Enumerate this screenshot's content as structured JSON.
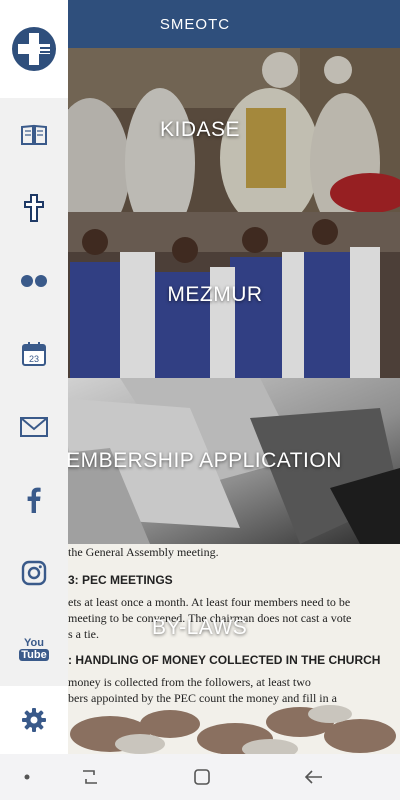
{
  "header": {
    "title": "SMEOTC"
  },
  "tiles": [
    {
      "label": "KIDASE"
    },
    {
      "label": "MEZMUR"
    },
    {
      "label": "MEMBERSHIP APPLICATION"
    },
    {
      "label": "BY-LAWS"
    }
  ],
  "bylaws_doc": {
    "line1": "the General Assembly meeting.",
    "heading1": "3: PEC MEETINGS",
    "para1a": "ets at least once a month. At least four members need to be",
    "para1b": "meeting to be convened. The chairman does not cast a vote",
    "para1c": "s a tie.",
    "heading2": ": HANDLING OF MONEY COLLECTED IN THE CHURCH",
    "para2a": "money is collected from the followers, at least two",
    "para2b": "bers appointed by the PEC count the money and fill in a"
  },
  "sidebar": {
    "items": [
      {
        "icon": "logo-icon"
      },
      {
        "icon": "book-icon"
      },
      {
        "icon": "cross-icon"
      },
      {
        "icon": "flickr-icon"
      },
      {
        "icon": "calendar-icon",
        "calendar_day": "23"
      },
      {
        "icon": "mail-icon"
      },
      {
        "icon": "facebook-icon"
      },
      {
        "icon": "instagram-icon"
      },
      {
        "icon": "youtube-icon",
        "text_top": "You",
        "text_bottom": "Tube"
      },
      {
        "icon": "gear-icon"
      }
    ]
  },
  "colors": {
    "header_bg": "#2f4f7c",
    "sidebar_icon": "#3a5a8a",
    "sidebar_bg": "#f1f1f1"
  }
}
